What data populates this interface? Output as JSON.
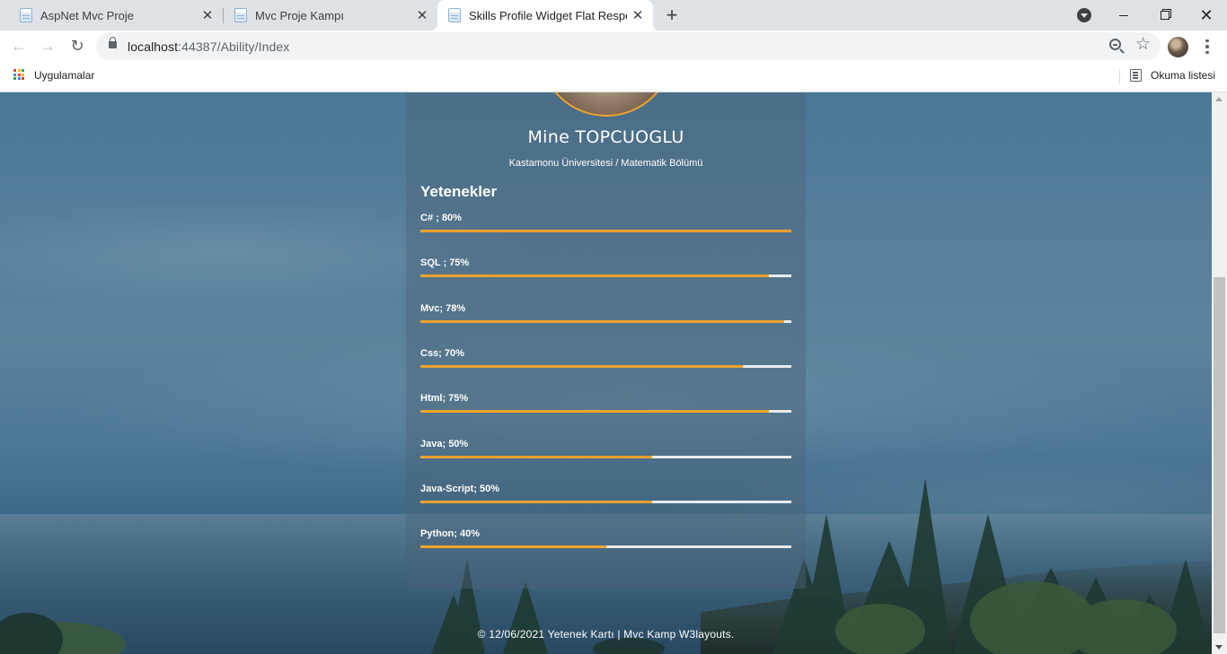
{
  "browser": {
    "tabs": [
      {
        "title": "AspNet Mvc Proje",
        "active": false
      },
      {
        "title": "Mvc Proje Kampı",
        "active": false
      },
      {
        "title": "Skills Profile Widget Flat Responsive",
        "active": true
      }
    ],
    "new_tab_symbol": "+",
    "close_symbol": "✕",
    "url_host": "localhost",
    "url_path": ":44387/Ability/Index",
    "bookmarks_apps_label": "Uygulamalar",
    "reading_list_label": "Okuma listesi"
  },
  "profile": {
    "name": "Mine TOPCUOGLU",
    "department": "Kastamonu Üniversitesi / Matematik Bölümü"
  },
  "skills_title": "Yetenekler",
  "skills": [
    {
      "label": "C# ; 80%",
      "level": 100
    },
    {
      "label": "SQL ; 75%",
      "level": 94
    },
    {
      "label": "Mvc; 78%",
      "level": 98
    },
    {
      "label": "Css; 70%",
      "level": 87
    },
    {
      "label": "Html; 75%",
      "level": 94
    },
    {
      "label": "Java; 50%",
      "level": 62.5
    },
    {
      "label": "Java-Script; 50%",
      "level": 62.5
    },
    {
      "label": "Python; 40%",
      "level": 50
    }
  ],
  "footer": "© 12/06/2021 Yetenek Kartı | Mvc Kamp W3layouts.",
  "colors": {
    "accent": "#f0a22e",
    "track": "#e8ebee",
    "apps_icon": [
      "#ea4335",
      "#fbbc05",
      "#34a853",
      "#4285f4",
      "#ea4335",
      "#fbbc05",
      "#34a853",
      "#4285f4",
      "#ea4335"
    ]
  }
}
